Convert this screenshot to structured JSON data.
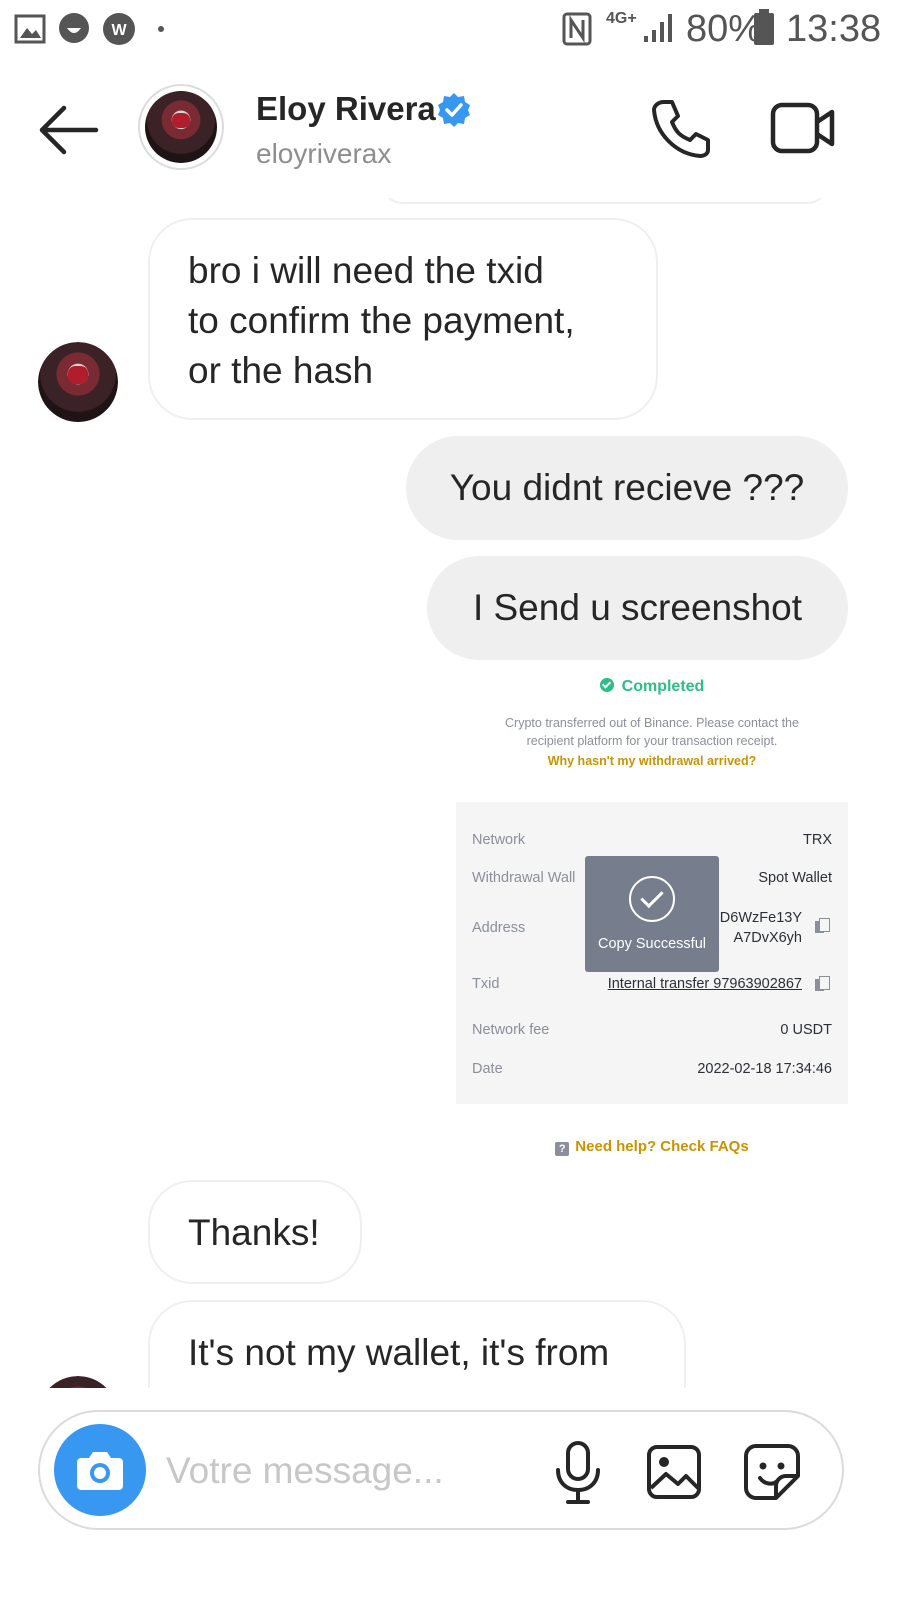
{
  "status_bar": {
    "battery": "80%",
    "time": "13:38",
    "network": "4G+"
  },
  "header": {
    "name": "Eloy Rivera",
    "username": "eloyriverax",
    "verified": true
  },
  "messages": [
    {
      "from": "them",
      "text_lines": [
        "bro i will need the txid",
        "to confirm the payment,",
        "or the hash"
      ]
    },
    {
      "from": "me",
      "text": "You didnt recieve ???"
    },
    {
      "from": "me",
      "text": "I Send u screenshot"
    },
    {
      "from": "me",
      "type": "image"
    },
    {
      "from": "them",
      "text": "Thanks!"
    },
    {
      "from": "them",
      "text": "It's not my wallet, it's from"
    }
  ],
  "screenshot": {
    "status": "Completed",
    "info": "Crypto transferred out of Binance. Please contact the recipient platform for your transaction receipt.",
    "why_link": "Why hasn't my withdrawal arrived?",
    "rows": {
      "network_label": "Network",
      "network_value": "TRX",
      "wallet_label": "Withdrawal Wall",
      "wallet_value": "Spot Wallet",
      "address_label": "Address",
      "address_line1": "D6WzFe13Y",
      "address_line2": "A7DvX6yh",
      "txid_label": "Txid",
      "txid_value": "Internal transfer 97963902867",
      "fee_label": "Network fee",
      "fee_value": "0 USDT",
      "date_label": "Date",
      "date_value": "2022-02-18 17:34:46"
    },
    "toast": "Copy Successful",
    "help": "Need help? Check FAQs"
  },
  "composer": {
    "placeholder": "Votre message..."
  },
  "colors": {
    "accent": "#3897f0",
    "verified": "#3897f0",
    "binance_green": "#2ebd85",
    "binance_yellow": "#c99400"
  }
}
